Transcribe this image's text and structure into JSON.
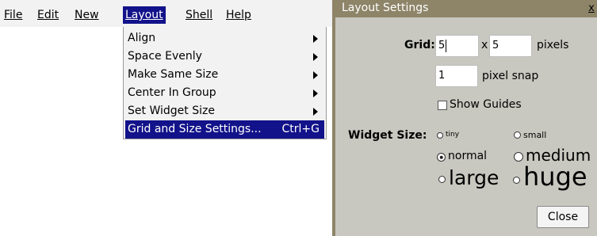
{
  "menubar": {
    "file": "File",
    "edit": "Edit",
    "new": "New",
    "layout": "Layout",
    "shell": "Shell",
    "help": "Help"
  },
  "layout_menu": {
    "items": [
      {
        "label": "Align",
        "submenu": true
      },
      {
        "label": "Space Evenly",
        "submenu": true
      },
      {
        "label": "Make Same Size",
        "submenu": true
      },
      {
        "label": "Center In Group",
        "submenu": true
      },
      {
        "label": "Set Widget Size",
        "submenu": true
      },
      {
        "label": "Grid and Size Settings...",
        "shortcut": "Ctrl+G",
        "selected": true
      }
    ]
  },
  "dialog": {
    "title": "Layout Settings",
    "close_glyph": "x",
    "grid_label": "Grid:",
    "grid_x": "5",
    "grid_sep": "x",
    "grid_y": "5",
    "grid_unit": "pixels",
    "snap_value": "1",
    "snap_label": "pixel snap",
    "show_guides_label": "Show Guides",
    "show_guides_checked": false,
    "widget_size_label": "Widget Size:",
    "sizes": [
      {
        "label": "tiny",
        "checked": false
      },
      {
        "label": "small",
        "checked": false
      },
      {
        "label": "normal",
        "checked": true
      },
      {
        "label": "medium",
        "checked": false
      },
      {
        "label": "large",
        "checked": false
      },
      {
        "label": "huge",
        "checked": false
      }
    ],
    "close_button": "Close"
  },
  "colors": {
    "menu_highlight": "#12128a",
    "dialog_title_bg": "#8e8468",
    "dialog_bg": "#c8c8c0"
  }
}
